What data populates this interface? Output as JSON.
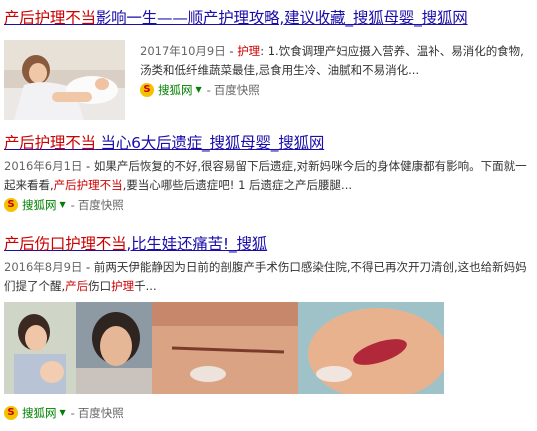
{
  "results": [
    {
      "title_hl": "产后护理不当",
      "title_rest": "影响一生——顺产护理攻略,建议收藏_搜狐母婴_搜狐网",
      "date": "2017年10月9日",
      "snippet_pre": " - ",
      "snippet_hl": "护理",
      "snippet_post": ": 1.饮食调理产妇应摄入营养、温补、易消化的食物,汤类和低纤维蔬菜最佳,忌食用生冷、油腻和不易消化...",
      "source": "搜狐网",
      "dash": "-",
      "snapshot": "百度快照"
    },
    {
      "title_hl": "产后护理不当",
      "title_rest": " 当心6大后遗症_搜狐母婴_搜狐网",
      "date": "2016年6月1日",
      "snippet_pre": " - 如果产后恢复的不好,很容易留下后遗症,对新妈咪今后的身体健康都有影响。下面就一起来看看,",
      "snippet_hl": "产后护理不当",
      "snippet_post": ",要当心哪些后遗症吧! 1 后遗症之产后腰腿...",
      "source": "搜狐网",
      "dash": "-",
      "snapshot": "百度快照"
    },
    {
      "title_hl": "产后伤口护理不当",
      "title_rest": ",比生娃还痛苦!_搜狐",
      "date": "2016年8月9日",
      "snippet_pre": " - 前两天伊能静因为日前的剖腹产手术伤口感染住院,不得已再次开刀清创,这也给新妈妈们提了个醒,",
      "snippet_hl": "产后",
      "snippet_mid": "伤口",
      "snippet_hl2": "护理",
      "snippet_post": "千...",
      "source": "搜狐网",
      "dash": "-",
      "snapshot": "百度快照"
    }
  ],
  "logo_char": "S",
  "caret": "▼"
}
